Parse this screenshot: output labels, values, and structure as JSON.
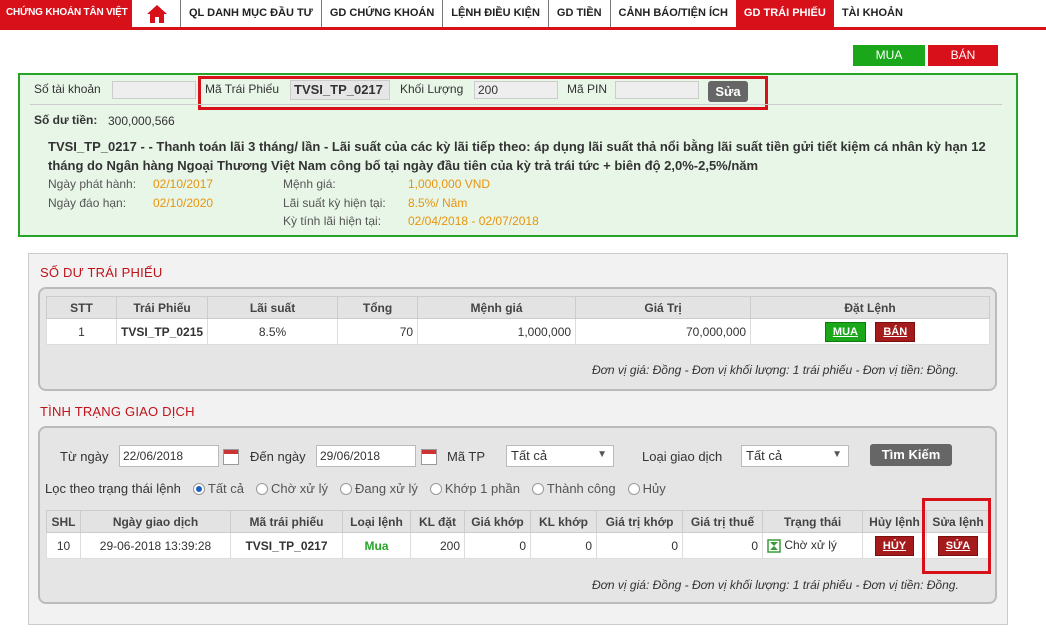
{
  "header": {
    "logo_text": "CHỨNG KHOÁN TÂN VIỆT",
    "nav": [
      {
        "label": "QL DANH MỤC ĐẦU TƯ"
      },
      {
        "label": "GD CHỨNG KHOÁN"
      },
      {
        "label": "LỆNH ĐIỀU KIỆN"
      },
      {
        "label": "GD TIỀN"
      },
      {
        "label": "CẢNH BÁO/TIỆN ÍCH"
      },
      {
        "label": "GD TRÁI PHIẾU",
        "active": true
      },
      {
        "label": "TÀI KHOẢN"
      }
    ]
  },
  "actions": {
    "buy": "MUA",
    "sell": "BÁN"
  },
  "order": {
    "account_label": "Số tài khoản",
    "account_value": "",
    "bond_code_label": "Mã Trái Phiếu",
    "bond_code_value": "TVSI_TP_0217",
    "volume_label": "Khối Lượng",
    "volume_value": "200",
    "pin_label": "Mã PIN",
    "pin_value": "",
    "edit_button": "Sửa",
    "balance_label": "Số dư tiền:",
    "balance_value": "300,000,566",
    "bond_title": "TVSI_TP_0217",
    "bond_desc": " - - Thanh toán lãi 3 tháng/ lần - Lãi suất của các kỳ lãi tiếp theo: áp dụng lãi suất thả nổi bằng lãi suất tiền gửi tiết kiệm cá nhân kỳ hạn 12 tháng do Ngân hàng Ngoại Thương Việt Nam công bố tại ngày đầu tiên của kỳ trả trái tức + biên độ 2,0%-2,5%/năm",
    "issue_date_label": "Ngày phát hành:",
    "issue_date": "02/10/2017",
    "maturity_label": "Ngày đáo hạn:",
    "maturity_date": "02/10/2020",
    "par_label": "Mệnh giá:",
    "par_value": "1,000,000 VND",
    "rate_label": "Lãi suất kỳ hiện tại:",
    "rate_value": "8.5%/ Năm",
    "period_label": "Kỳ tính lãi hiện tại:",
    "period_value": "02/04/2018 - 02/07/2018"
  },
  "holdings": {
    "title": "SỐ DƯ TRÁI PHIẾU",
    "headers": [
      "STT",
      "Trái Phiếu",
      "Lãi suất",
      "Tổng",
      "Mệnh giá",
      "Giá Trị",
      "Đặt Lệnh"
    ],
    "rows": [
      {
        "stt": "1",
        "bond": "TVSI_TP_0215",
        "rate": "8.5%",
        "total": "70",
        "par": "1,000,000",
        "value": "70,000,000",
        "buy": "MUA",
        "sell": "BÁN"
      }
    ],
    "note": "Đơn vị giá: Đồng - Đơn vị khối lượng: 1 trái phiếu - Đơn vị tiền: Đồng."
  },
  "transactions": {
    "title": "TÌNH TRẠNG GIAO DỊCH",
    "from_label": "Từ ngày",
    "from_value": "22/06/2018",
    "to_label": "Đến ngày",
    "to_value": "29/06/2018",
    "code_label": "Mã TP",
    "code_value": "Tất cả",
    "type_label": "Loại giao dịch",
    "type_value": "Tất cả",
    "search_button": "Tìm Kiếm",
    "filter_label": "Lọc theo trạng thái lệnh",
    "filters": [
      "Tất cả",
      "Chờ xử lý",
      "Đang xử lý",
      "Khớp 1 phần",
      "Thành công",
      "Hủy"
    ],
    "headers": [
      "SHL",
      "Ngày giao dịch",
      "Mã trái phiếu",
      "Loại lệnh",
      "KL đặt",
      "Giá khớp",
      "KL khớp",
      "Giá trị khớp",
      "Giá trị thuế",
      "Trạng thái",
      "Hủy lệnh",
      "Sửa lệnh"
    ],
    "rows": [
      {
        "shl": "10",
        "date": "29-06-2018 13:39:28",
        "code": "TVSI_TP_0217",
        "type": "Mua",
        "qty": "200",
        "match_price": "0",
        "match_qty": "0",
        "match_value": "0",
        "tax": "0",
        "status": "Chờ xử lý",
        "cancel": "HỦY",
        "edit": "SỬA"
      }
    ],
    "note": "Đơn vị giá: Đồng - Đơn vị khối lượng: 1 trái phiếu - Đơn vị tiền: Đồng."
  }
}
